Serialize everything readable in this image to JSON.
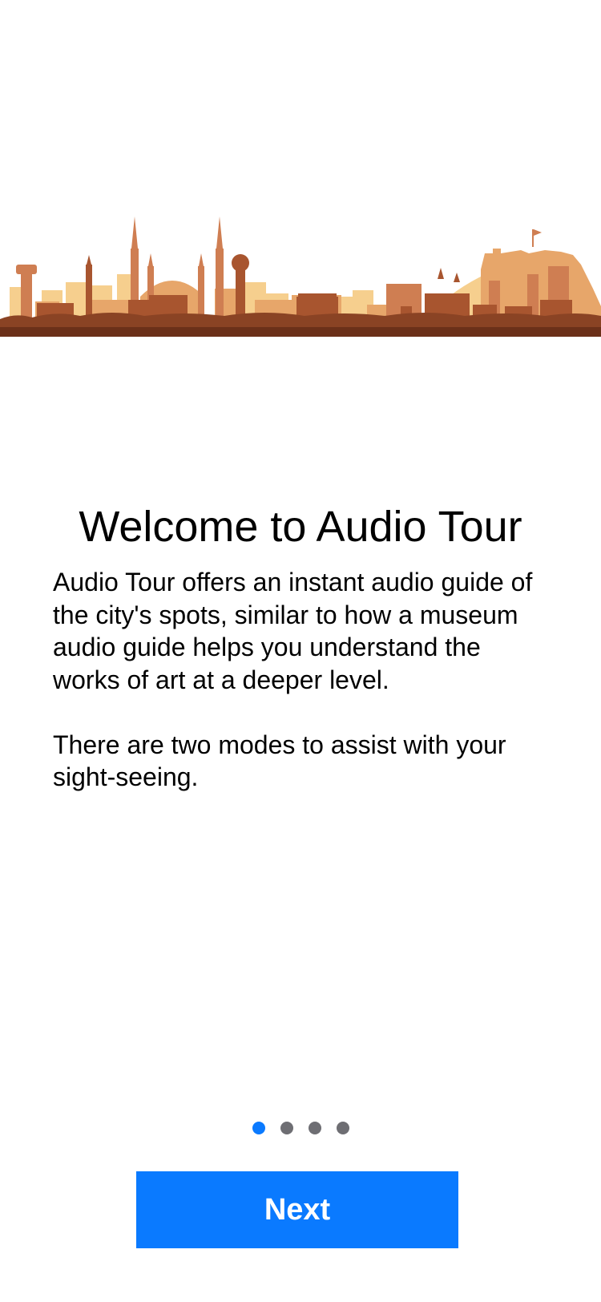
{
  "onboarding": {
    "title": "Welcome to Audio Tour",
    "paragraphs": [
      "Audio Tour offers an instant audio guide of the city's spots, similar to how a museum audio guide helps you understand the works of art at a deeper level.",
      "There are two modes to assist with your sight-seeing."
    ],
    "page_indicator": {
      "current_page": 1,
      "total_pages": 4
    },
    "next_label": "Next"
  },
  "colors": {
    "accent": "#0a7aff",
    "inactive_dot": "#6e6e73",
    "skyline_light": "#f4c27a",
    "skyline_mid": "#d88a5a",
    "skyline_dark": "#7a3a1f"
  },
  "icons": {
    "hero": "city-skyline-illustration"
  }
}
